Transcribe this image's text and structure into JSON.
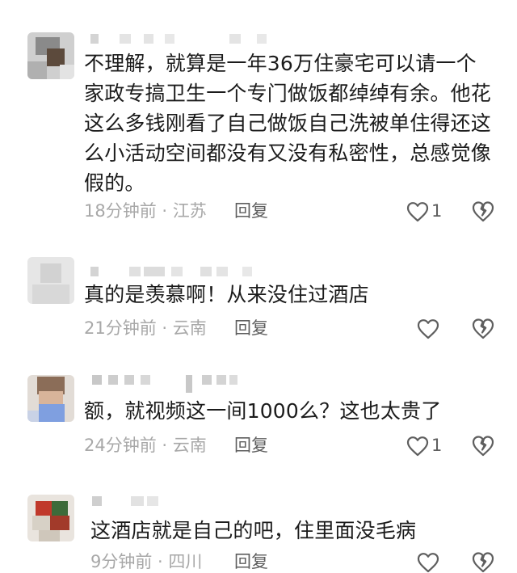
{
  "comments": [
    {
      "text": "不理解，就算是一年36万住豪宅可以请一个家政专搞卫生一个专门做饭都绰绰有余。他花这么多钱刚看了自己做饭自己洗被单住得还这么小活动空间都没有又没有私密性，总感觉像假的。",
      "time": "18分钟前",
      "location": "江苏",
      "reply_label": "回复",
      "likes": "1"
    },
    {
      "text": "真的是羡慕啊！从来没住过酒店",
      "time": "21分钟前",
      "location": "云南",
      "reply_label": "回复",
      "likes": ""
    },
    {
      "text": "额，就视频这一间1000么？这也太贵了",
      "time": "24分钟前",
      "location": "云南",
      "reply_label": "回复",
      "likes": "1"
    },
    {
      "text": "这酒店就是自己的吧，住里面没毛病",
      "time": "9分钟前",
      "location": "四川",
      "reply_label": "回复",
      "likes": ""
    }
  ],
  "icons": {
    "like": "heart-outline-icon",
    "dislike": "broken-heart-icon"
  },
  "colors": {
    "text": "#1b1b1b",
    "meta": "#a8a8a8",
    "action": "#5e5e5e",
    "background": "#ffffff"
  }
}
